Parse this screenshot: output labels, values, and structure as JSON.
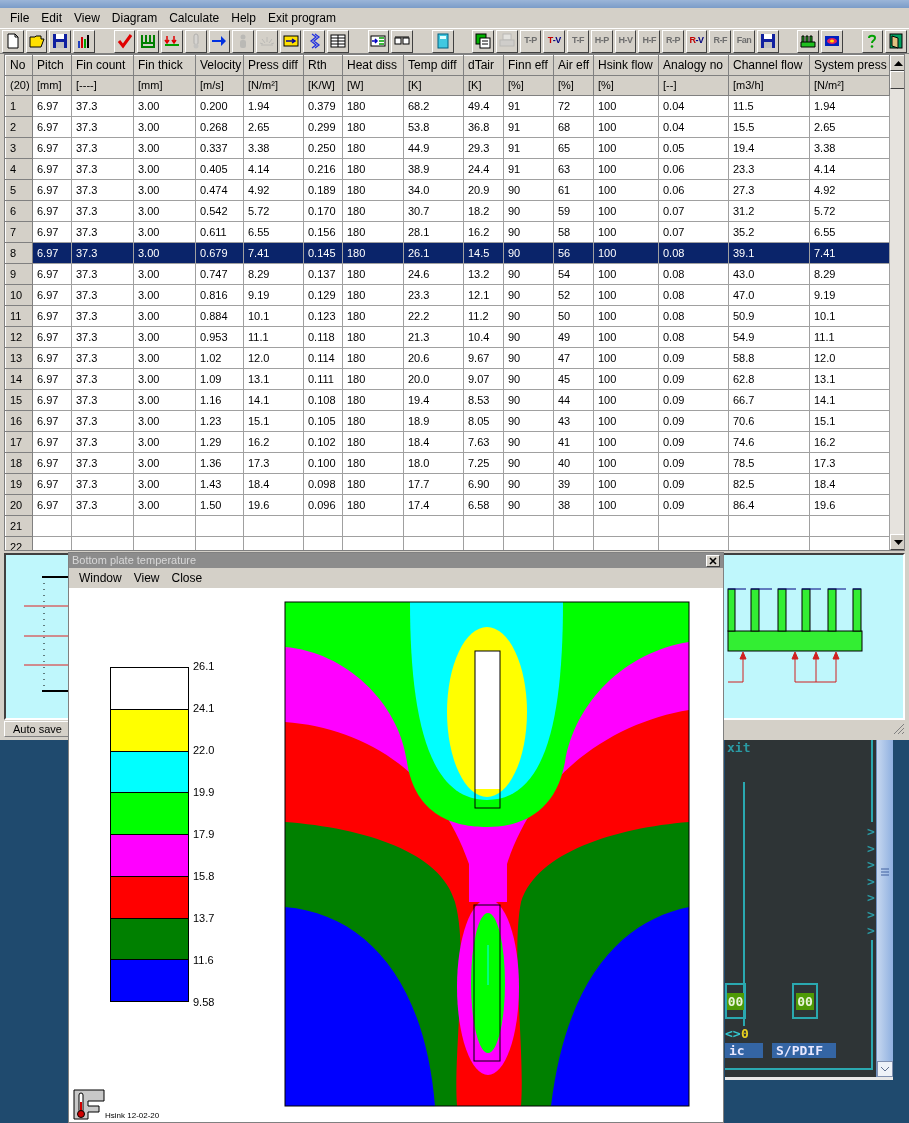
{
  "menu": [
    "File",
    "Edit",
    "View",
    "Diagram",
    "Calculate",
    "Help",
    "Exit program"
  ],
  "toolbar": [
    {
      "kind": "icon",
      "disabled": false
    },
    {
      "kind": "icon",
      "disabled": false
    },
    {
      "kind": "icon",
      "disabled": false
    },
    {
      "kind": "icon",
      "disabled": false
    },
    {
      "kind": "gap"
    },
    {
      "kind": "icon",
      "disabled": false
    },
    {
      "kind": "icon",
      "disabled": false
    },
    {
      "kind": "icon",
      "disabled": false
    },
    {
      "kind": "icon",
      "disabled": true
    },
    {
      "kind": "icon",
      "disabled": false
    },
    {
      "kind": "icon",
      "disabled": true
    },
    {
      "kind": "icon",
      "disabled": true
    },
    {
      "kind": "icon",
      "disabled": false
    },
    {
      "kind": "icon",
      "disabled": false
    },
    {
      "kind": "icon",
      "disabled": false
    },
    {
      "kind": "gap"
    },
    {
      "kind": "icon",
      "disabled": false
    },
    {
      "kind": "icon",
      "disabled": false
    },
    {
      "kind": "gap"
    },
    {
      "kind": "icon",
      "disabled": false
    },
    {
      "kind": "gap"
    },
    {
      "kind": "icon",
      "disabled": false
    },
    {
      "kind": "icon",
      "disabled": true
    },
    {
      "kind": "text",
      "label": "T-P",
      "disabled": true
    },
    {
      "kind": "text",
      "label": "T-V",
      "disabled": false
    },
    {
      "kind": "text",
      "label": "T-F",
      "disabled": true
    },
    {
      "kind": "text",
      "label": "H-P",
      "disabled": true
    },
    {
      "kind": "text",
      "label": "H-V",
      "disabled": true
    },
    {
      "kind": "text",
      "label": "H-F",
      "disabled": true
    },
    {
      "kind": "text",
      "label": "R-P",
      "disabled": true
    },
    {
      "kind": "text",
      "label": "R-V",
      "disabled": false
    },
    {
      "kind": "text",
      "label": "R-F",
      "disabled": true
    },
    {
      "kind": "text",
      "label": "Fan",
      "disabled": true
    },
    {
      "kind": "icon",
      "disabled": false
    },
    {
      "kind": "gap"
    },
    {
      "kind": "icon",
      "disabled": false
    },
    {
      "kind": "icon",
      "disabled": false
    },
    {
      "kind": "gap"
    },
    {
      "kind": "icon",
      "disabled": false
    },
    {
      "kind": "icon",
      "disabled": false
    }
  ],
  "table": {
    "columns": [
      {
        "name": "No",
        "unit": "(20)"
      },
      {
        "name": "Pitch",
        "unit": "[mm]"
      },
      {
        "name": "Fin count",
        "unit": "[----]"
      },
      {
        "name": "Fin thick",
        "unit": "[mm]"
      },
      {
        "name": "Velocity",
        "unit": "[m/s]"
      },
      {
        "name": "Press diff",
        "unit": "[N/m²]"
      },
      {
        "name": "Rth",
        "unit": "[K/W]"
      },
      {
        "name": "Heat diss",
        "unit": "[W]"
      },
      {
        "name": "Temp diff",
        "unit": "[K]"
      },
      {
        "name": "dTair",
        "unit": "[K]"
      },
      {
        "name": "Finn eff",
        "unit": "[%]"
      },
      {
        "name": "Air eff",
        "unit": "[%]"
      },
      {
        "name": "Hsink flow",
        "unit": "[%]"
      },
      {
        "name": "Analogy no",
        "unit": "[--]"
      },
      {
        "name": "Channel flow",
        "unit": "[m3/h]"
      },
      {
        "name": "System press",
        "unit": "[N/m²]"
      }
    ],
    "rows": [
      {
        "selected": false,
        "cells": [
          "1",
          "6.97",
          "37.3",
          "3.00",
          "0.200",
          "1.94",
          "0.379",
          "180",
          "68.2",
          "49.4",
          "91",
          "72",
          "100",
          "0.04",
          "11.5",
          "1.94"
        ]
      },
      {
        "selected": false,
        "cells": [
          "2",
          "6.97",
          "37.3",
          "3.00",
          "0.268",
          "2.65",
          "0.299",
          "180",
          "53.8",
          "36.8",
          "91",
          "68",
          "100",
          "0.04",
          "15.5",
          "2.65"
        ]
      },
      {
        "selected": false,
        "cells": [
          "3",
          "6.97",
          "37.3",
          "3.00",
          "0.337",
          "3.38",
          "0.250",
          "180",
          "44.9",
          "29.3",
          "91",
          "65",
          "100",
          "0.05",
          "19.4",
          "3.38"
        ]
      },
      {
        "selected": false,
        "cells": [
          "4",
          "6.97",
          "37.3",
          "3.00",
          "0.405",
          "4.14",
          "0.216",
          "180",
          "38.9",
          "24.4",
          "91",
          "63",
          "100",
          "0.06",
          "23.3",
          "4.14"
        ]
      },
      {
        "selected": false,
        "cells": [
          "5",
          "6.97",
          "37.3",
          "3.00",
          "0.474",
          "4.92",
          "0.189",
          "180",
          "34.0",
          "20.9",
          "90",
          "61",
          "100",
          "0.06",
          "27.3",
          "4.92"
        ]
      },
      {
        "selected": false,
        "cells": [
          "6",
          "6.97",
          "37.3",
          "3.00",
          "0.542",
          "5.72",
          "0.170",
          "180",
          "30.7",
          "18.2",
          "90",
          "59",
          "100",
          "0.07",
          "31.2",
          "5.72"
        ]
      },
      {
        "selected": false,
        "cells": [
          "7",
          "6.97",
          "37.3",
          "3.00",
          "0.611",
          "6.55",
          "0.156",
          "180",
          "28.1",
          "16.2",
          "90",
          "58",
          "100",
          "0.07",
          "35.2",
          "6.55"
        ]
      },
      {
        "selected": true,
        "cells": [
          "8",
          "6.97",
          "37.3",
          "3.00",
          "0.679",
          "7.41",
          "0.145",
          "180",
          "26.1",
          "14.5",
          "90",
          "56",
          "100",
          "0.08",
          "39.1",
          "7.41"
        ]
      },
      {
        "selected": false,
        "cells": [
          "9",
          "6.97",
          "37.3",
          "3.00",
          "0.747",
          "8.29",
          "0.137",
          "180",
          "24.6",
          "13.2",
          "90",
          "54",
          "100",
          "0.08",
          "43.0",
          "8.29"
        ]
      },
      {
        "selected": false,
        "cells": [
          "10",
          "6.97",
          "37.3",
          "3.00",
          "0.816",
          "9.19",
          "0.129",
          "180",
          "23.3",
          "12.1",
          "90",
          "52",
          "100",
          "0.08",
          "47.0",
          "9.19"
        ]
      },
      {
        "selected": false,
        "cells": [
          "11",
          "6.97",
          "37.3",
          "3.00",
          "0.884",
          "10.1",
          "0.123",
          "180",
          "22.2",
          "11.2",
          "90",
          "50",
          "100",
          "0.08",
          "50.9",
          "10.1"
        ]
      },
      {
        "selected": false,
        "cells": [
          "12",
          "6.97",
          "37.3",
          "3.00",
          "0.953",
          "11.1",
          "0.118",
          "180",
          "21.3",
          "10.4",
          "90",
          "49",
          "100",
          "0.08",
          "54.9",
          "11.1"
        ]
      },
      {
        "selected": false,
        "cells": [
          "13",
          "6.97",
          "37.3",
          "3.00",
          "1.02",
          "12.0",
          "0.114",
          "180",
          "20.6",
          "9.67",
          "90",
          "47",
          "100",
          "0.09",
          "58.8",
          "12.0"
        ]
      },
      {
        "selected": false,
        "cells": [
          "14",
          "6.97",
          "37.3",
          "3.00",
          "1.09",
          "13.1",
          "0.111",
          "180",
          "20.0",
          "9.07",
          "90",
          "45",
          "100",
          "0.09",
          "62.8",
          "13.1"
        ]
      },
      {
        "selected": false,
        "cells": [
          "15",
          "6.97",
          "37.3",
          "3.00",
          "1.16",
          "14.1",
          "0.108",
          "180",
          "19.4",
          "8.53",
          "90",
          "44",
          "100",
          "0.09",
          "66.7",
          "14.1"
        ]
      },
      {
        "selected": false,
        "cells": [
          "16",
          "6.97",
          "37.3",
          "3.00",
          "1.23",
          "15.1",
          "0.105",
          "180",
          "18.9",
          "8.05",
          "90",
          "43",
          "100",
          "0.09",
          "70.6",
          "15.1"
        ]
      },
      {
        "selected": false,
        "cells": [
          "17",
          "6.97",
          "37.3",
          "3.00",
          "1.29",
          "16.2",
          "0.102",
          "180",
          "18.4",
          "7.63",
          "90",
          "41",
          "100",
          "0.09",
          "74.6",
          "16.2"
        ]
      },
      {
        "selected": false,
        "cells": [
          "18",
          "6.97",
          "37.3",
          "3.00",
          "1.36",
          "17.3",
          "0.100",
          "180",
          "18.0",
          "7.25",
          "90",
          "40",
          "100",
          "0.09",
          "78.5",
          "17.3"
        ]
      },
      {
        "selected": false,
        "cells": [
          "19",
          "6.97",
          "37.3",
          "3.00",
          "1.43",
          "18.4",
          "0.098",
          "180",
          "17.7",
          "6.90",
          "90",
          "39",
          "100",
          "0.09",
          "82.5",
          "18.4"
        ]
      },
      {
        "selected": false,
        "cells": [
          "20",
          "6.97",
          "37.3",
          "3.00",
          "1.50",
          "19.6",
          "0.096",
          "180",
          "17.4",
          "6.58",
          "90",
          "38",
          "100",
          "0.09",
          "86.4",
          "19.6"
        ]
      },
      {
        "selected": false,
        "cells": [
          "21"
        ]
      },
      {
        "selected": false,
        "cells": [
          "22"
        ]
      }
    ]
  },
  "status_bar": {
    "button": "Auto save"
  },
  "plot_window": {
    "title": "Bottom plate temperature",
    "menu": [
      "Window",
      "View",
      "Close"
    ],
    "legend": {
      "labels": [
        "26.1",
        "24.1",
        "22.0",
        "19.9",
        "17.9",
        "15.8",
        "13.7",
        "11.6",
        "9.58"
      ],
      "bands": [
        {
          "color": "#ffffff"
        },
        {
          "color": "#ffff00"
        },
        {
          "color": "#00ffff"
        },
        {
          "color": "#00ff00"
        },
        {
          "color": "#ff00ff"
        },
        {
          "color": "#ff0000"
        },
        {
          "color": "#008000"
        },
        {
          "color": "#0000ff"
        }
      ]
    },
    "footer": "Hsink 12-02-20"
  },
  "background_window": {
    "top_text": "xit",
    "meters": [
      {
        "value": "00",
        "label": "ic"
      },
      {
        "value": "00",
        "label": "S/PDIF"
      }
    ],
    "balance_mark": "<>",
    "balance_value": "0",
    "scale_marks": [
      ">",
      ">",
      ">",
      ">",
      ">",
      ">",
      ">"
    ]
  }
}
